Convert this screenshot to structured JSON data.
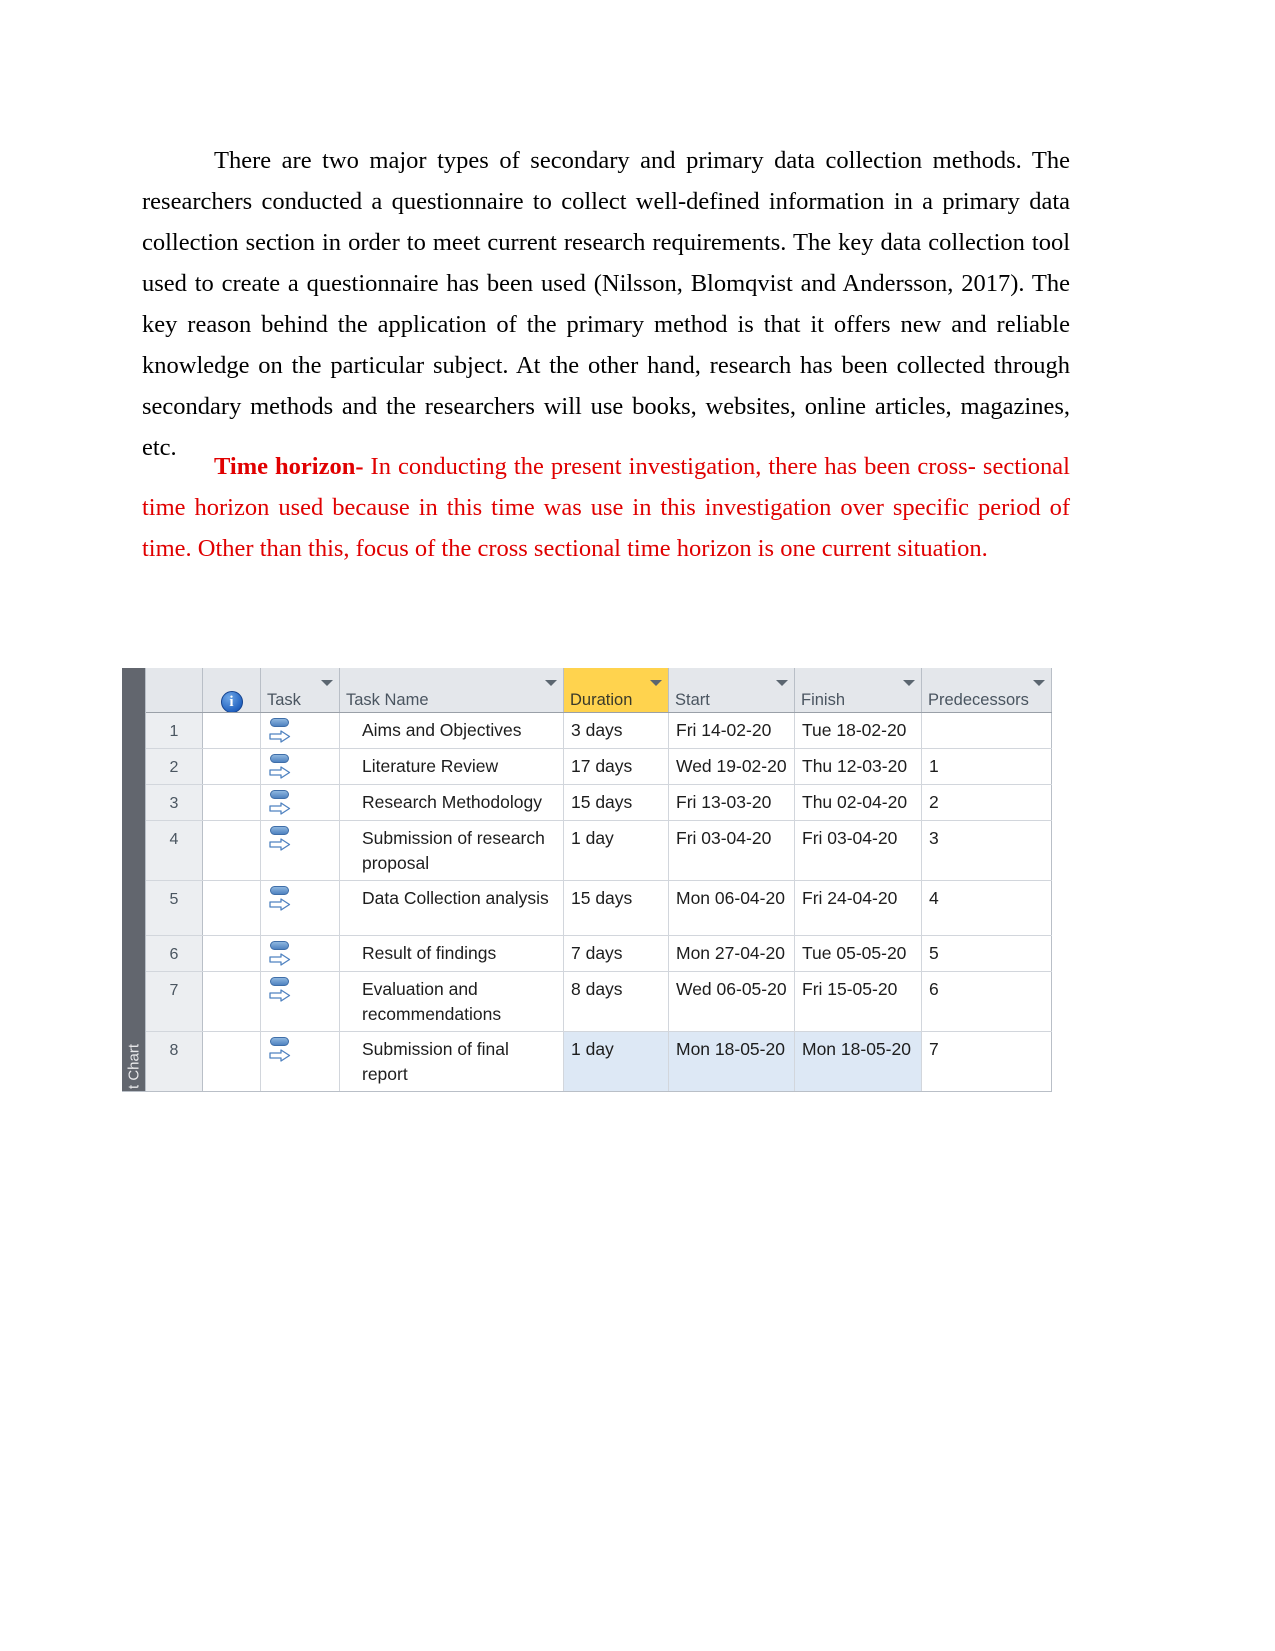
{
  "document": {
    "paragraph_1": "There are two major types of secondary and primary data collection methods. The researchers conducted a questionnaire to collect well-defined information in a primary data collection section in order to meet current research requirements. The key data collection tool used to create a questionnaire has been used (Nilsson, Blomqvist and Andersson, 2017). The key reason behind the application of the primary method is that it offers new and reliable knowledge on the particular subject. At the other hand, research has been collected through secondary methods and the researchers will use books, websites, online articles, magazines, etc.",
    "paragraph_2_lead": "Time horizon-",
    "paragraph_2_rest": " In conducting the present investigation, there has been cross- sectional time horizon used because in this time was use in this investigation over specific period of time. Other than this, focus of the cross sectional time horizon is one current situation.",
    "paragraph_2_color": "#e00000"
  },
  "gantt": {
    "view_strip_label": "t Chart",
    "header_highlight_color": "#ffd34e",
    "selection_color": "#dde8f5",
    "headers": {
      "row_number": "",
      "info": "i",
      "task_mode": "Task\nMode",
      "task_name": "Task Name",
      "duration": "Duration",
      "start": "Start",
      "finish": "Finish",
      "predecessors": "Predecessors"
    },
    "rows": [
      {
        "id": "1",
        "mode": "auto-scheduled",
        "name": "Aims and Objectives",
        "duration": "3 days",
        "start": "Fri 14-02-20",
        "finish": "Tue 18-02-20",
        "predecessors": "",
        "selected": false
      },
      {
        "id": "2",
        "mode": "auto-scheduled",
        "name": "Literature Review",
        "duration": "17 days",
        "start": "Wed 19-02-20",
        "finish": "Thu 12-03-20",
        "predecessors": "1",
        "selected": false
      },
      {
        "id": "3",
        "mode": "auto-scheduled",
        "name": "Research Methodology",
        "duration": "15 days",
        "start": "Fri 13-03-20",
        "finish": "Thu 02-04-20",
        "predecessors": "2",
        "selected": false
      },
      {
        "id": "4",
        "mode": "auto-scheduled",
        "name": "Submission of research proposal",
        "duration": "1 day",
        "start": "Fri 03-04-20",
        "finish": "Fri 03-04-20",
        "predecessors": "3",
        "selected": false
      },
      {
        "id": "5",
        "mode": "auto-scheduled",
        "name": "Data Collection analysis",
        "duration": "15 days",
        "start": "Mon 06-04-20",
        "finish": "Fri 24-04-20",
        "predecessors": "4",
        "selected": false
      },
      {
        "id": "6",
        "mode": "auto-scheduled",
        "name": "Result of findings",
        "duration": "7 days",
        "start": "Mon 27-04-20",
        "finish": "Tue 05-05-20",
        "predecessors": "5",
        "selected": false
      },
      {
        "id": "7",
        "mode": "auto-scheduled",
        "name": "Evaluation and recommendations",
        "duration": "8 days",
        "start": "Wed 06-05-20",
        "finish": "Fri 15-05-20",
        "predecessors": "6",
        "selected": false
      },
      {
        "id": "8",
        "mode": "auto-scheduled",
        "name": "Submission of final report",
        "duration": "1 day",
        "start": "Mon 18-05-20",
        "finish": "Mon 18-05-20",
        "predecessors": "7",
        "selected": true
      }
    ]
  }
}
